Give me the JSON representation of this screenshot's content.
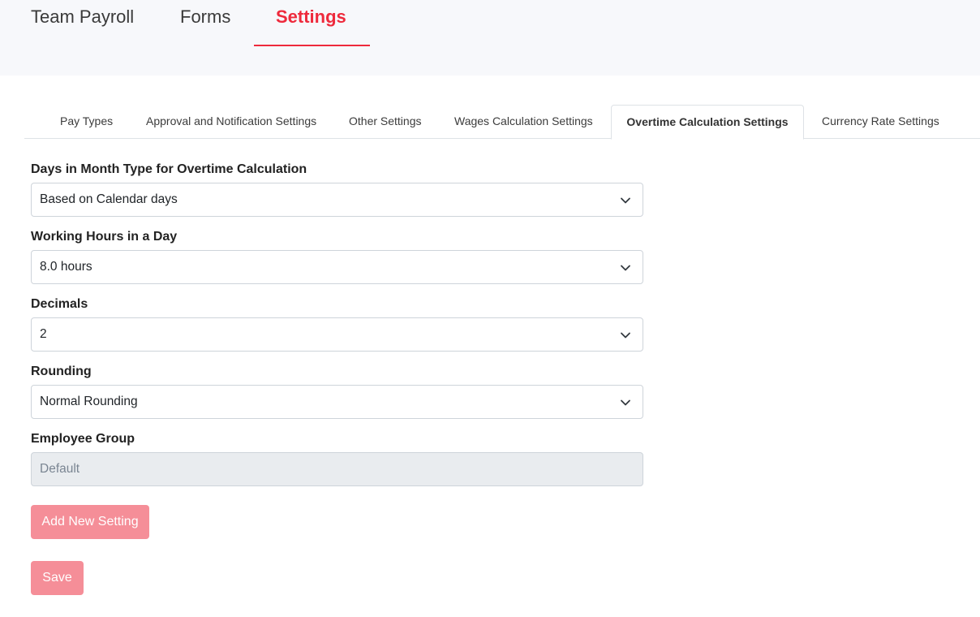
{
  "header": {
    "tabs": [
      {
        "label": "Team Payroll"
      },
      {
        "label": "Forms"
      },
      {
        "label": "Settings"
      }
    ],
    "active_tab": "Settings"
  },
  "subtabs": [
    {
      "label": "Pay Types"
    },
    {
      "label": "Approval and Notification Settings"
    },
    {
      "label": "Other Settings"
    },
    {
      "label": "Wages Calculation Settings"
    },
    {
      "label": "Overtime Calculation Settings"
    },
    {
      "label": "Currency Rate Settings"
    }
  ],
  "active_subtab": "Overtime Calculation Settings",
  "form": {
    "days_in_month": {
      "label": "Days in Month Type for Overtime Calculation",
      "value": "Based on Calendar days"
    },
    "working_hours": {
      "label": "Working Hours in a Day",
      "value": "8.0 hours"
    },
    "decimals": {
      "label": "Decimals",
      "value": "2"
    },
    "rounding": {
      "label": "Rounding",
      "value": "Normal Rounding"
    },
    "employee_group": {
      "label": "Employee Group",
      "placeholder": "Default"
    }
  },
  "buttons": {
    "add_new_setting": "Add New Setting",
    "save": "Save"
  },
  "colors": {
    "accent": "#ee2a3c",
    "button_disabled": "#f58e98",
    "header_bg": "#f7f8fb"
  }
}
